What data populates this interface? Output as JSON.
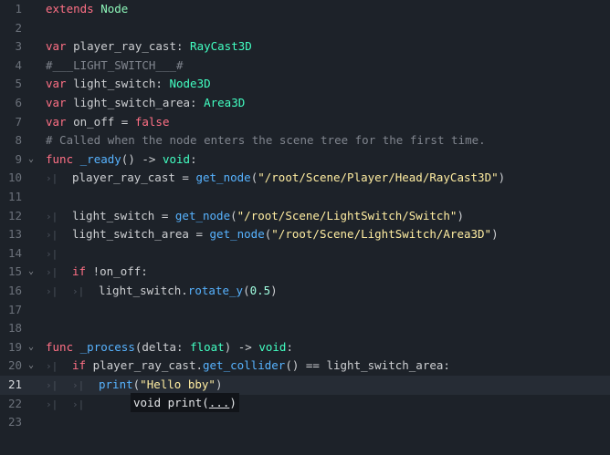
{
  "editor": {
    "current_line": 21,
    "lines": [
      {
        "n": "1",
        "fold": false,
        "indent": 0,
        "tokens": [
          {
            "c": "kw",
            "t": "extends"
          },
          {
            "c": "tx",
            "t": " "
          },
          {
            "c": "nd",
            "t": "Node"
          }
        ]
      },
      {
        "n": "2",
        "fold": false,
        "indent": 0,
        "tokens": []
      },
      {
        "n": "3",
        "fold": false,
        "indent": 0,
        "tokens": [
          {
            "c": "kw",
            "t": "var"
          },
          {
            "c": "tx",
            "t": " player_ray_cast: "
          },
          {
            "c": "ty",
            "t": "RayCast3D"
          }
        ]
      },
      {
        "n": "4",
        "fold": false,
        "indent": 0,
        "tokens": [
          {
            "c": "cm",
            "t": "#___LIGHT_SWITCH___#"
          }
        ]
      },
      {
        "n": "5",
        "fold": false,
        "indent": 0,
        "tokens": [
          {
            "c": "kw",
            "t": "var"
          },
          {
            "c": "tx",
            "t": " light_switch: "
          },
          {
            "c": "ty",
            "t": "Node3D"
          }
        ]
      },
      {
        "n": "6",
        "fold": false,
        "indent": 0,
        "tokens": [
          {
            "c": "kw",
            "t": "var"
          },
          {
            "c": "tx",
            "t": " light_switch_area: "
          },
          {
            "c": "ty",
            "t": "Area3D"
          }
        ]
      },
      {
        "n": "7",
        "fold": false,
        "indent": 0,
        "tokens": [
          {
            "c": "kw",
            "t": "var"
          },
          {
            "c": "tx",
            "t": " on_off = "
          },
          {
            "c": "kw",
            "t": "false"
          }
        ]
      },
      {
        "n": "8",
        "fold": false,
        "indent": 0,
        "tokens": [
          {
            "c": "cm",
            "t": "# Called when the node enters the scene tree for the first time."
          }
        ]
      },
      {
        "n": "9",
        "fold": true,
        "indent": 0,
        "tokens": [
          {
            "c": "kw",
            "t": "func"
          },
          {
            "c": "tx",
            "t": " "
          },
          {
            "c": "fn",
            "t": "_ready"
          },
          {
            "c": "tx",
            "t": "() -> "
          },
          {
            "c": "ty",
            "t": "void"
          },
          {
            "c": "tx",
            "t": ":"
          }
        ]
      },
      {
        "n": "10",
        "fold": false,
        "indent": 1,
        "tokens": [
          {
            "c": "tx",
            "t": "player_ray_cast = "
          },
          {
            "c": "fn",
            "t": "get_node"
          },
          {
            "c": "tx",
            "t": "("
          },
          {
            "c": "st",
            "t": "\"/root/Scene/Player/Head/RayCast3D\""
          },
          {
            "c": "tx",
            "t": ")"
          }
        ]
      },
      {
        "n": "11",
        "fold": false,
        "indent": 0,
        "tokens": []
      },
      {
        "n": "12",
        "fold": false,
        "indent": 1,
        "tokens": [
          {
            "c": "tx",
            "t": "light_switch = "
          },
          {
            "c": "fn",
            "t": "get_node"
          },
          {
            "c": "tx",
            "t": "("
          },
          {
            "c": "st",
            "t": "\"/root/Scene/LightSwitch/Switch\""
          },
          {
            "c": "tx",
            "t": ")"
          }
        ]
      },
      {
        "n": "13",
        "fold": false,
        "indent": 1,
        "tokens": [
          {
            "c": "tx",
            "t": "light_switch_area = "
          },
          {
            "c": "fn",
            "t": "get_node"
          },
          {
            "c": "tx",
            "t": "("
          },
          {
            "c": "st",
            "t": "\"/root/Scene/LightSwitch/Area3D\""
          },
          {
            "c": "tx",
            "t": ")"
          }
        ]
      },
      {
        "n": "14",
        "fold": false,
        "indent": 1,
        "tokens": []
      },
      {
        "n": "15",
        "fold": true,
        "indent": 1,
        "tokens": [
          {
            "c": "kw",
            "t": "if"
          },
          {
            "c": "tx",
            "t": " !on_off:"
          }
        ]
      },
      {
        "n": "16",
        "fold": false,
        "indent": 2,
        "tokens": [
          {
            "c": "tx",
            "t": "light_switch."
          },
          {
            "c": "fn",
            "t": "rotate_y"
          },
          {
            "c": "tx",
            "t": "("
          },
          {
            "c": "nm",
            "t": "0.5"
          },
          {
            "c": "tx",
            "t": ")"
          }
        ]
      },
      {
        "n": "17",
        "fold": false,
        "indent": 0,
        "tokens": []
      },
      {
        "n": "18",
        "fold": false,
        "indent": 0,
        "tokens": []
      },
      {
        "n": "19",
        "fold": true,
        "indent": 0,
        "tokens": [
          {
            "c": "kw",
            "t": "func"
          },
          {
            "c": "tx",
            "t": " "
          },
          {
            "c": "fn",
            "t": "_process"
          },
          {
            "c": "tx",
            "t": "(delta: "
          },
          {
            "c": "ty",
            "t": "float"
          },
          {
            "c": "tx",
            "t": ") -> "
          },
          {
            "c": "ty",
            "t": "void"
          },
          {
            "c": "tx",
            "t": ":"
          }
        ]
      },
      {
        "n": "20",
        "fold": true,
        "indent": 1,
        "tokens": [
          {
            "c": "kw",
            "t": "if"
          },
          {
            "c": "tx",
            "t": " player_ray_cast."
          },
          {
            "c": "fn",
            "t": "get_collider"
          },
          {
            "c": "tx",
            "t": "() == light_switch_area:"
          }
        ]
      },
      {
        "n": "21",
        "fold": false,
        "indent": 2,
        "tokens": [
          {
            "c": "fn",
            "t": "print"
          },
          {
            "c": "tx",
            "t": "("
          },
          {
            "c": "st",
            "t": "\"Hello bby\""
          },
          {
            "c": "tx",
            "t": ")"
          }
        ]
      },
      {
        "n": "22",
        "fold": false,
        "indent": 2,
        "tokens": []
      },
      {
        "n": "23",
        "fold": false,
        "indent": 0,
        "tokens": []
      }
    ]
  },
  "tab_glyph": "›|",
  "fold_glyph": "⌄",
  "call_hint": {
    "prefix": "void print(",
    "arg": "...",
    "suffix": ")"
  }
}
